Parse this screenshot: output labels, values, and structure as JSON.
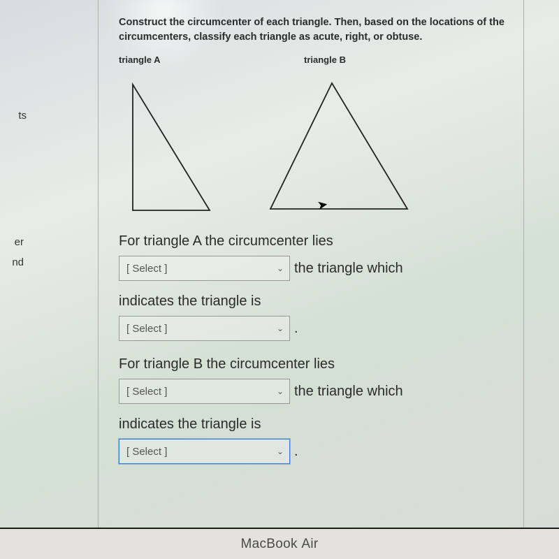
{
  "instructions": "Construct the circumcenter of each triangle. Then, based on the locations of the circumcenters, classify each triangle as acute, right, or obtuse.",
  "labels": {
    "triangleA": "triangle A",
    "triangleB": "triangle B"
  },
  "sidebar": {
    "item1": "ts",
    "item2": "er",
    "item3": "nd"
  },
  "questionA": {
    "line1": "For triangle A the circumcenter lies",
    "select1_placeholder": "[ Select ]",
    "suffix1": "the triangle which",
    "line2": "indicates the triangle is",
    "select2_placeholder": "[ Select ]",
    "suffix2": "."
  },
  "questionB": {
    "line1": "For triangle B the circumcenter lies",
    "select1_placeholder": "[ Select ]",
    "suffix1": "the triangle which",
    "line2": "indicates the triangle is",
    "select2_placeholder": "[ Select ]",
    "suffix2": "."
  },
  "device_label": {
    "brand": "MacBook ",
    "model": "Air"
  }
}
